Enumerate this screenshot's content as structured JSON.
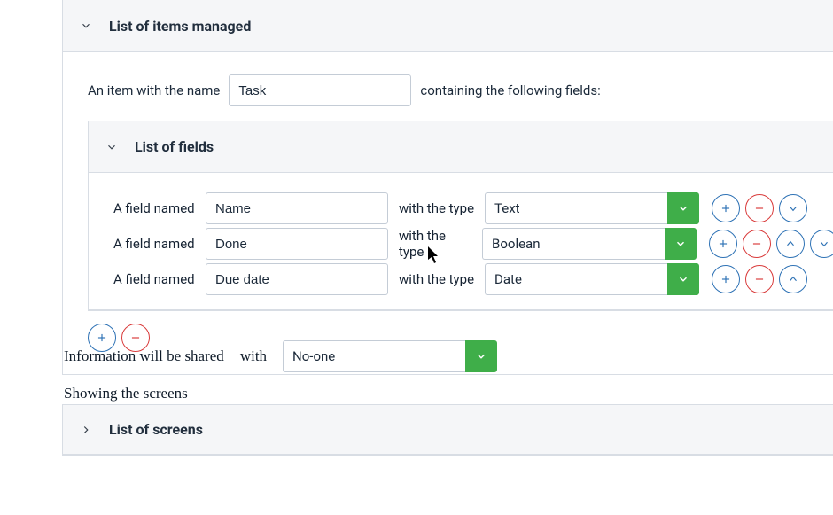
{
  "items_panel": {
    "title": "List of items managed",
    "item_pre_text": "An item with the name",
    "item_name_value": "Task",
    "item_post_text": "containing the following fields:"
  },
  "fields_panel": {
    "title": "List of fields",
    "row_pre_text": "A field named",
    "row_mid_text": "with the type",
    "rows": [
      {
        "name": "Name",
        "type": "Text"
      },
      {
        "name": "Done",
        "type": "Boolean"
      },
      {
        "name": "Due date",
        "type": "Date"
      }
    ]
  },
  "share_row": {
    "pre_text": "Information will be shared",
    "with_text": "with",
    "value": "No-one"
  },
  "screens": {
    "showing_text": "Showing the screens",
    "title": "List of screens"
  }
}
